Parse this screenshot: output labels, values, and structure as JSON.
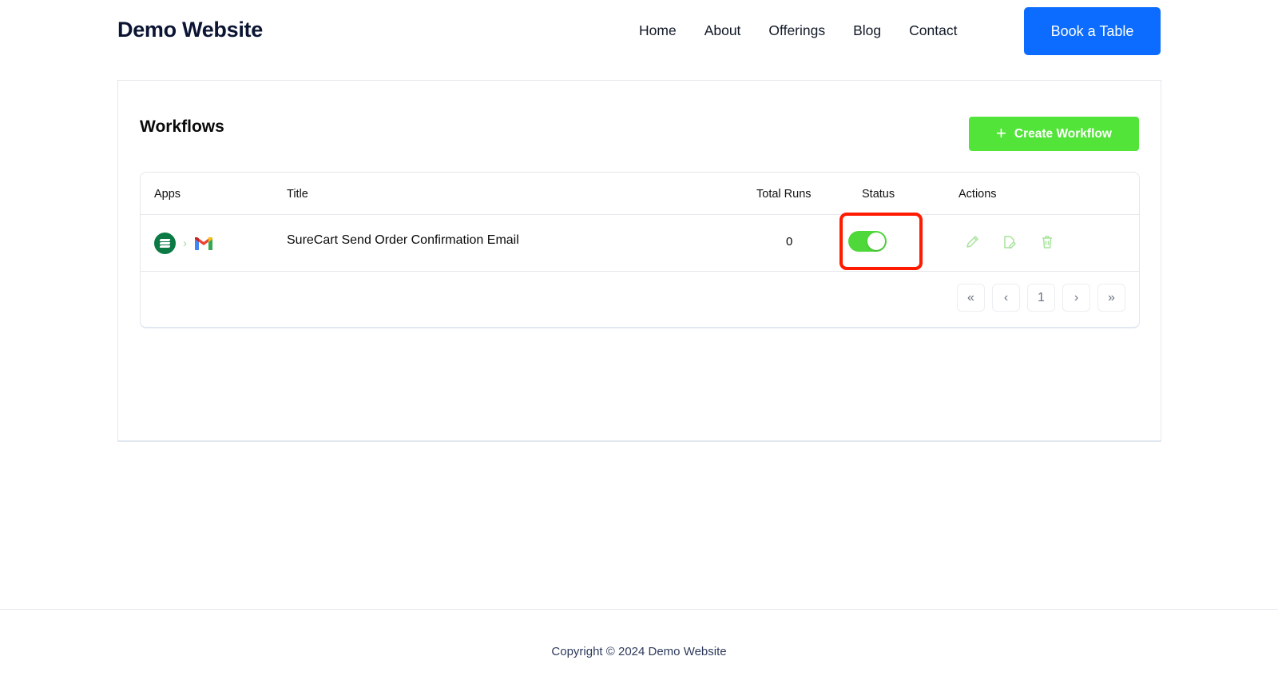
{
  "header": {
    "brand": "Demo Website",
    "nav": [
      {
        "label": "Home"
      },
      {
        "label": "About"
      },
      {
        "label": "Offerings"
      },
      {
        "label": "Blog"
      },
      {
        "label": "Contact"
      }
    ],
    "cta_label": "Book a Table",
    "cta_color": "#0b6cff"
  },
  "workflows": {
    "title": "Workflows",
    "create_label": "Create Workflow",
    "create_icon": "plus-icon",
    "create_color": "#53e43a",
    "columns": [
      "Apps",
      "Title",
      "Total Runs",
      "Status",
      "Actions"
    ],
    "rows": [
      {
        "apps": [
          "surecart-icon",
          "gmail-icon"
        ],
        "app_separator": "›",
        "title": "SureCart Send Order Confirmation Email",
        "total_runs": "0",
        "status_on": true,
        "actions": [
          "edit-pencil-icon",
          "edit-document-icon",
          "trash-icon"
        ]
      }
    ],
    "pagination": {
      "first": "«",
      "prev": "‹",
      "current": "1",
      "next": "›",
      "last": "»"
    }
  },
  "footer": {
    "copyright": "Copyright © 2024 Demo Website"
  }
}
